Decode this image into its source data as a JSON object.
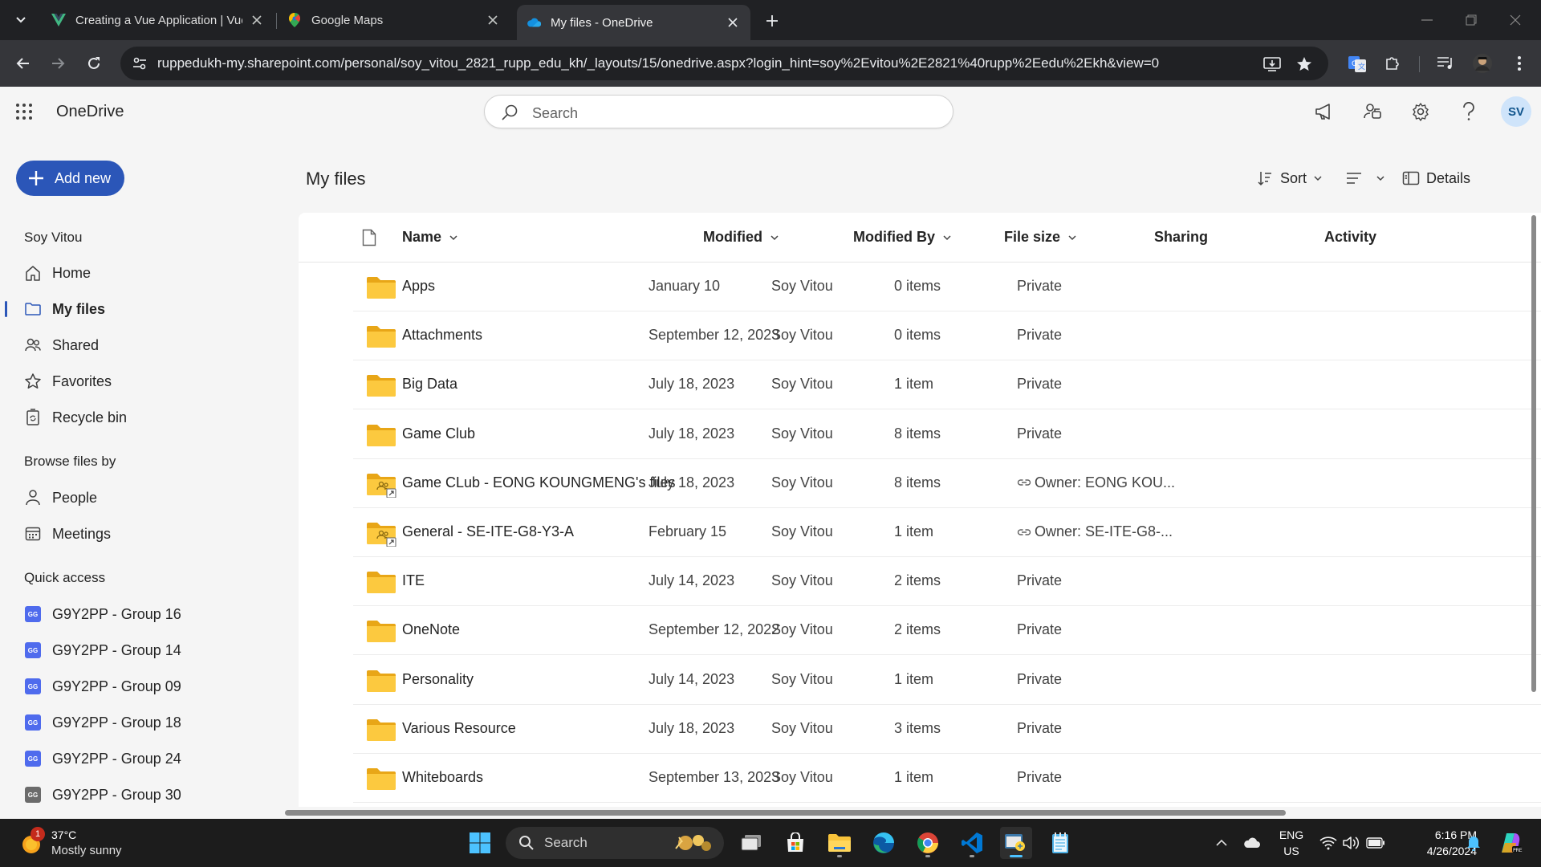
{
  "browser": {
    "tabs": [
      {
        "title": "Creating a Vue Application | Vue.js",
        "icon": "vue-icon"
      },
      {
        "title": "Google Maps",
        "icon": "maps-pin-icon"
      },
      {
        "title": "My files - OneDrive",
        "icon": "onedrive-cloud-icon",
        "active": true
      }
    ],
    "url": "ruppedukh-my.sharepoint.com/personal/soy_vitou_2821_rupp_edu_kh/_layouts/15/onedrive.aspx?login_hint=soy%2Evitou%2E2821%40rupp%2Eedu%2Ekh&view=0"
  },
  "app": {
    "brand": "OneDrive",
    "search_placeholder": "Search",
    "avatar_initials": "SV",
    "accent": "#2b56b8"
  },
  "sidebar": {
    "add_new": "Add new",
    "user_name": "Soy Vitou",
    "items": [
      {
        "label": "Home",
        "icon": "home-icon"
      },
      {
        "label": "My files",
        "icon": "folder-icon",
        "selected": true
      },
      {
        "label": "Shared",
        "icon": "people-icon"
      },
      {
        "label": "Favorites",
        "icon": "star-icon"
      },
      {
        "label": "Recycle bin",
        "icon": "recycle-bin-icon"
      }
    ],
    "browse_heading": "Browse files by",
    "browse_items": [
      {
        "label": "People",
        "icon": "person-icon"
      },
      {
        "label": "Meetings",
        "icon": "calendar-icon"
      }
    ],
    "quick_access_heading": "Quick access",
    "quick_access": [
      {
        "label": "G9Y2PP - Group 16",
        "badge": "GG"
      },
      {
        "label": "G9Y2PP - Group 14",
        "badge": "GG"
      },
      {
        "label": "G9Y2PP - Group 09",
        "badge": "GG"
      },
      {
        "label": "G9Y2PP - Group 18",
        "badge": "GG"
      },
      {
        "label": "G9Y2PP - Group 24",
        "badge": "GG"
      },
      {
        "label": "G9Y2PP - Group 30",
        "badge": "GG"
      }
    ]
  },
  "main": {
    "title": "My files",
    "commands": {
      "sort": "Sort",
      "details": "Details"
    },
    "columns": {
      "name": "Name",
      "modified": "Modified",
      "modified_by": "Modified By",
      "file_size": "File size",
      "sharing": "Sharing",
      "activity": "Activity"
    },
    "rows": [
      {
        "name": "Apps",
        "modified": "January 10",
        "by": "Soy Vitou",
        "size": "0 items",
        "sharing": "Private",
        "shared": false
      },
      {
        "name": "Attachments",
        "modified": "September 12, 2023",
        "by": "Soy Vitou",
        "size": "0 items",
        "sharing": "Private",
        "shared": false
      },
      {
        "name": "Big Data",
        "modified": "July 18, 2023",
        "by": "Soy Vitou",
        "size": "1 item",
        "sharing": "Private",
        "shared": false
      },
      {
        "name": "Game Club",
        "modified": "July 18, 2023",
        "by": "Soy Vitou",
        "size": "8 items",
        "sharing": "Private",
        "shared": false
      },
      {
        "name": "Game CLub - EONG KOUNGMENG's files",
        "modified": "July 18, 2023",
        "by": "Soy Vitou",
        "size": "8 items",
        "sharing": "Owner: EONG KOU...",
        "shared": true
      },
      {
        "name": "General - SE-ITE-G8-Y3-A",
        "modified": "February 15",
        "by": "Soy Vitou",
        "size": "1 item",
        "sharing": "Owner: SE-ITE-G8-...",
        "shared": true
      },
      {
        "name": "ITE",
        "modified": "July 14, 2023",
        "by": "Soy Vitou",
        "size": "2 items",
        "sharing": "Private",
        "shared": false
      },
      {
        "name": "OneNote",
        "modified": "September 12, 2022",
        "by": "Soy Vitou",
        "size": "2 items",
        "sharing": "Private",
        "shared": false
      },
      {
        "name": "Personality",
        "modified": "July 14, 2023",
        "by": "Soy Vitou",
        "size": "1 item",
        "sharing": "Private",
        "shared": false
      },
      {
        "name": "Various Resource",
        "modified": "July 18, 2023",
        "by": "Soy Vitou",
        "size": "3 items",
        "sharing": "Private",
        "shared": false
      },
      {
        "name": "Whiteboards",
        "modified": "September 13, 2023",
        "by": "Soy Vitou",
        "size": "1 item",
        "sharing": "Private",
        "shared": false
      }
    ]
  },
  "taskbar": {
    "weather_temp": "37°C",
    "weather_cond": "Mostly sunny",
    "weather_badge": "1",
    "search": "Search",
    "lang_1": "ENG",
    "lang_2": "US",
    "time": "6:16 PM",
    "date": "4/26/2024"
  }
}
